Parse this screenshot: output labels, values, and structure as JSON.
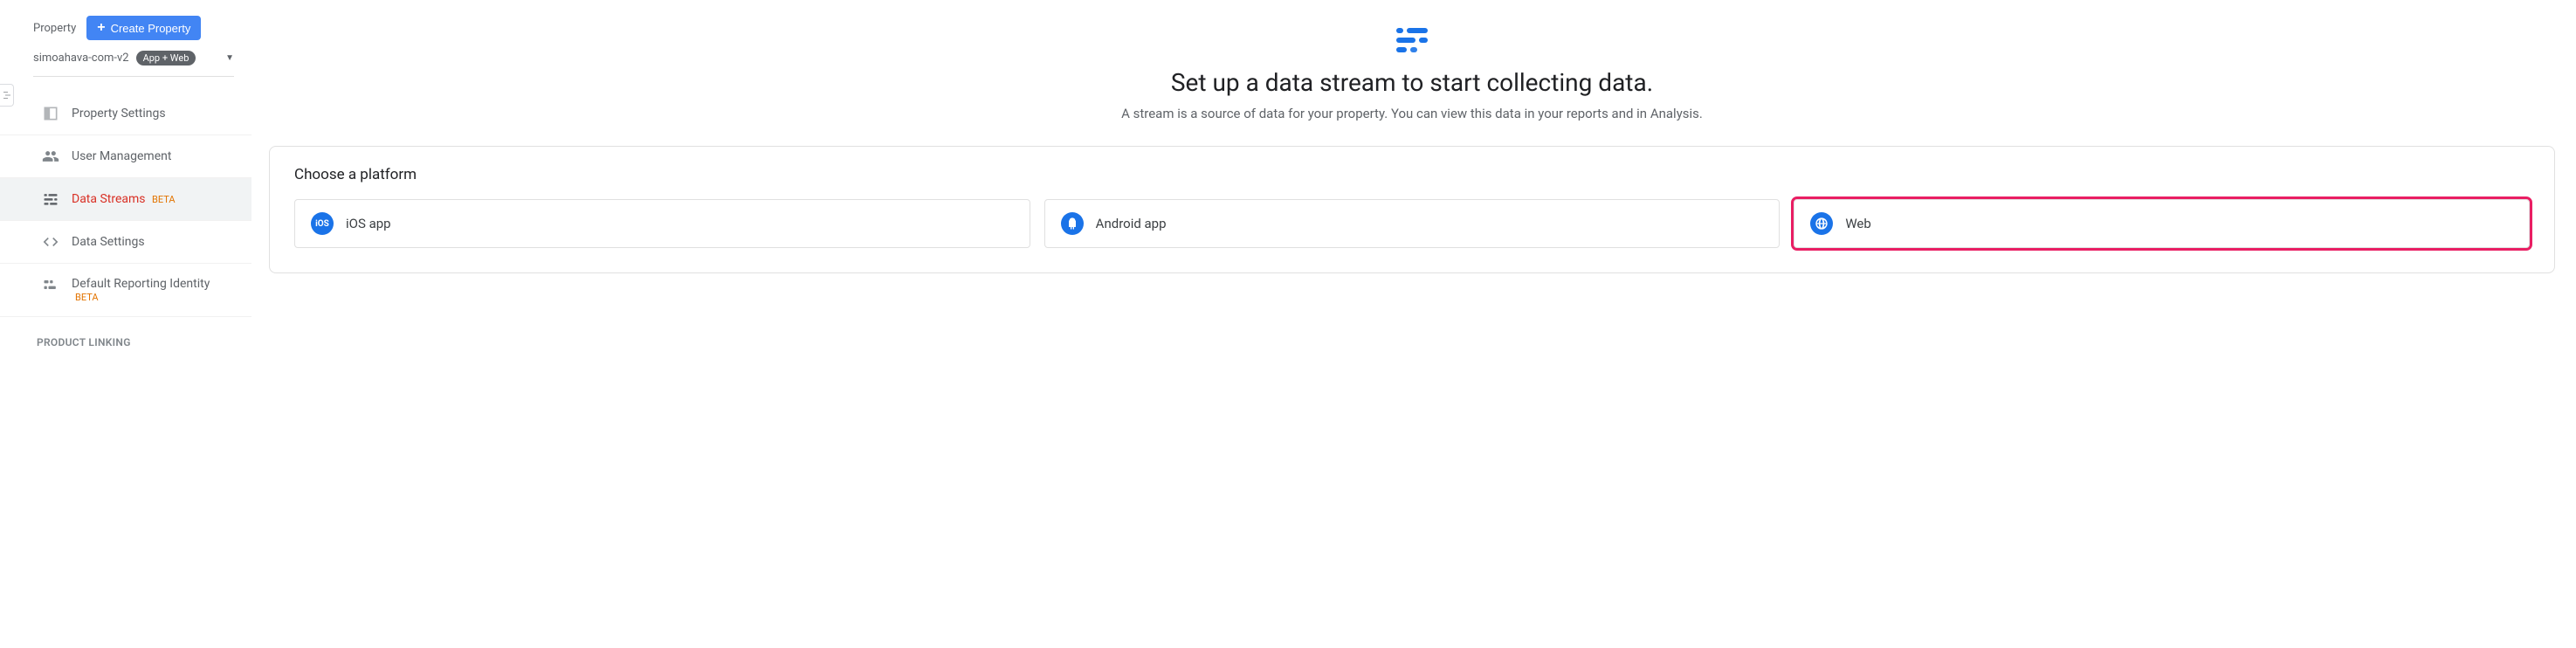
{
  "header": {
    "property_label": "Property",
    "create_button": "Create Property",
    "selected_property": "simoahava-com-v2",
    "selected_badge": "App + Web"
  },
  "sidebar": {
    "items": [
      {
        "label": "Property Settings",
        "beta": ""
      },
      {
        "label": "User Management",
        "beta": ""
      },
      {
        "label": "Data Streams",
        "beta": "BETA"
      },
      {
        "label": "Data Settings",
        "beta": ""
      },
      {
        "label": "Default Reporting Identity",
        "beta": "BETA"
      }
    ],
    "section": "PRODUCT LINKING"
  },
  "hero": {
    "title": "Set up a data stream to start collecting data.",
    "subtitle": "A stream is a source of data for your property. You can view this data in your reports and in Analysis."
  },
  "panel": {
    "title": "Choose a platform",
    "platforms": [
      {
        "label": "iOS app",
        "code": "iOS"
      },
      {
        "label": "Android app",
        "code": ""
      },
      {
        "label": "Web",
        "code": ""
      }
    ]
  }
}
